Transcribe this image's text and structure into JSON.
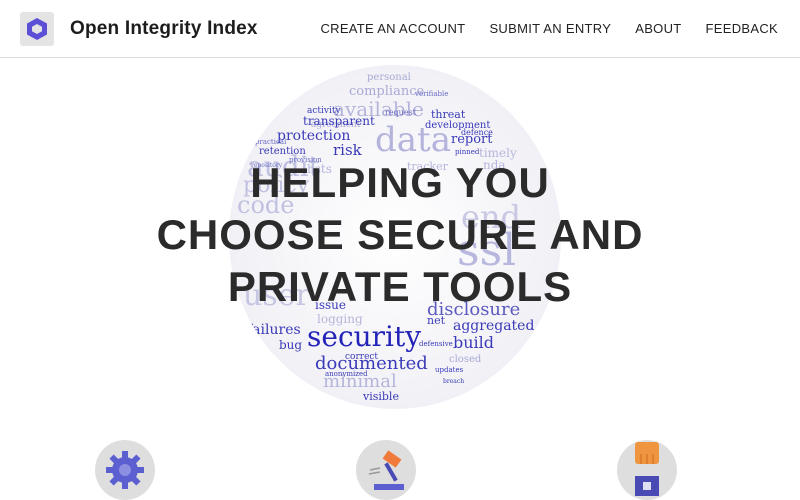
{
  "header": {
    "brand": "Open Integrity Index",
    "nav": [
      "CREATE AN ACCOUNT",
      "SUBMIT AN ENTRY",
      "ABOUT",
      "FEEDBACK"
    ]
  },
  "hero": {
    "headline": [
      "HELPING YOU",
      "CHOOSE SECURE AND",
      "PRIVATE TOOLS"
    ],
    "word_cloud": [
      "personal",
      "compliance",
      "available",
      "agreement",
      "verifiable",
      "activity",
      "transparent",
      "threat",
      "development",
      "data",
      "protection",
      "report",
      "defence",
      "practical",
      "retention",
      "risk",
      "audit",
      "timely",
      "tracker",
      "nda",
      "policy",
      "code",
      "end",
      "ssl",
      "user",
      "issue",
      "disclosure",
      "logging",
      "aggregated",
      "failures",
      "security",
      "build",
      "bug",
      "documented",
      "correct",
      "closed",
      "anonymized",
      "minimal",
      "updates",
      "visible",
      "net",
      "defensive",
      "repository",
      "provision",
      "request",
      "hsts",
      "pinned",
      "breach"
    ]
  },
  "features": [
    {
      "icon": "gear-icon"
    },
    {
      "icon": "hammer-icon"
    },
    {
      "icon": "hand-icon"
    }
  ],
  "colors": {
    "accent": "#5b4fd6",
    "cloud_text": "#3a3ab8",
    "light_text": "#a9a9d6"
  }
}
